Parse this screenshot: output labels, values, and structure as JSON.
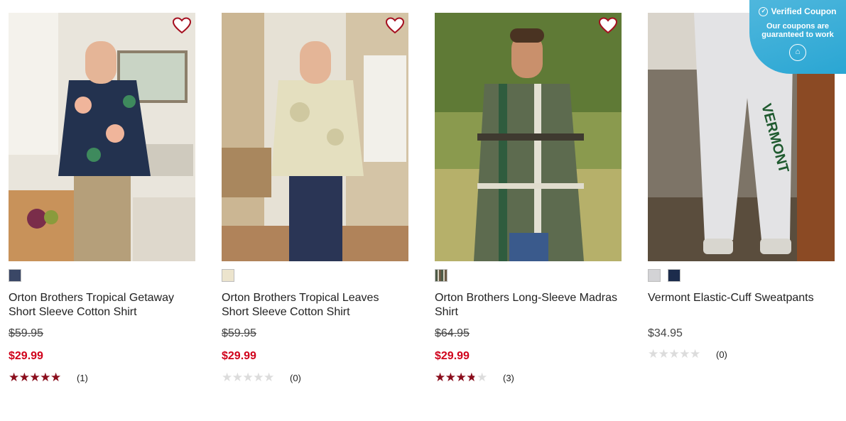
{
  "products": [
    {
      "title": "Orton Brothers Tropical Getaway Short Sleeve Cotton Shirt",
      "original_price": "$59.95",
      "sale_price": "$29.99",
      "rating": 5,
      "review_count": "(1)",
      "swatches": [
        "#3a4766"
      ]
    },
    {
      "title": "Orton Brothers Tropical Leaves Short Sleeve Cotton Shirt",
      "original_price": "$59.95",
      "sale_price": "$29.99",
      "rating": 0,
      "review_count": "(0)",
      "swatches": [
        "#ece4cd"
      ]
    },
    {
      "title": "Orton Brothers Long-Sleeve Madras Shirt",
      "original_price": "$64.95",
      "sale_price": "$29.99",
      "rating": 3.5,
      "review_count": "(3)",
      "swatches": [
        "#6b6659"
      ]
    },
    {
      "title": "Vermont Elastic-Cuff Sweatpants",
      "price": "$34.95",
      "rating": 0,
      "review_count": "(0)",
      "swatches": [
        "#d3d3d6",
        "#1c2c4c"
      ]
    }
  ],
  "coupon": {
    "title": "Verified Coupon",
    "text": "Our coupons are guaranteed to work",
    "icon": "coupon-badge-icon"
  },
  "colors": {
    "sale": "#d0021b",
    "star": "#8b0d1c",
    "heart": "#a50f1f",
    "coupon_bg": "#3aaed8"
  }
}
